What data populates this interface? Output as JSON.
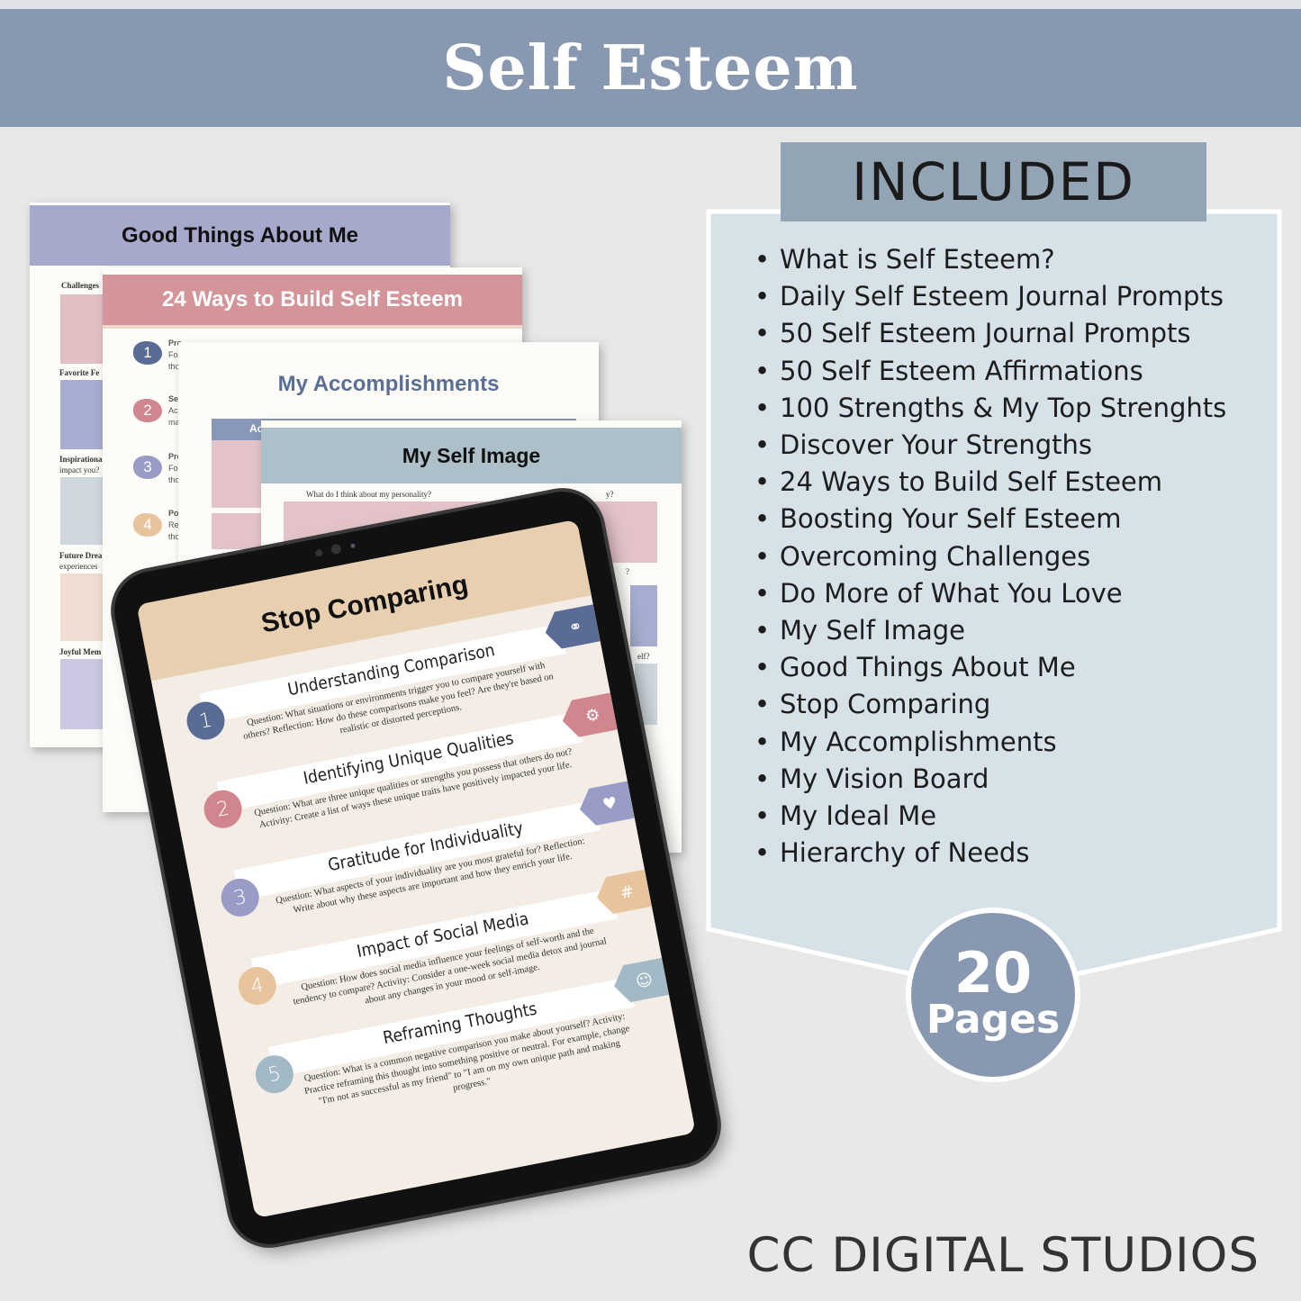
{
  "title": "Self Esteem",
  "colors": {
    "banner": "#8898b0",
    "panel": "#d6e1e8",
    "panel_header": "#93a5b5",
    "navy": "#5a6c96",
    "rose": "#d4959a",
    "lavender": "#9a9cc8",
    "sand": "#e8cfb0",
    "blue_grey": "#a3bac6"
  },
  "pages": {
    "good_things": {
      "title": "Good Things About Me",
      "labels": [
        "Challenges",
        "Favorite Fe",
        "Inspirationa",
        "impact you?",
        "Future Drea",
        "experiences",
        "Joyful Mem"
      ]
    },
    "ways": {
      "title": "24 Ways to Build Self Esteem",
      "numbers": [
        "1",
        "2",
        "3",
        "4"
      ],
      "stubs": [
        "Pro",
        "Foc",
        "tho",
        "Se",
        "Ack",
        "ma",
        "Pro",
        "Foc",
        "tho",
        "Po",
        "Rep",
        "tho"
      ]
    },
    "accomplishments": {
      "title": "My Accomplishments",
      "bar_stub": "Ac"
    },
    "self_image": {
      "title": "My Self Image",
      "question": "What do I think about my personality?",
      "stub1": "y?",
      "stub2": "?",
      "stub3": "elf?"
    }
  },
  "tablet": {
    "title": "Stop Comparing",
    "rows": [
      {
        "num": "1",
        "title": "Understanding Comparison",
        "text": "Question: What situations or environments trigger you to compare yourself with others? Reflection: How do these comparisons make you feel?  Are they're based on realistic or distorted perceptions.",
        "icon": "binoculars-icon",
        "color": "#5a6c96"
      },
      {
        "num": "2",
        "title": "Identifying Unique Qualities",
        "text": "Question: What are three unique qualities or strengths you possess that others do not? Activity: Create a list of ways these unique traits have positively impacted your life.",
        "icon": "magnifier-gear-icon",
        "color": "#d0868c"
      },
      {
        "num": "3",
        "title": "Gratitude for Individuality",
        "text": "Question: What aspects of your individuality are you most grateful for? Reflection: Write about why these aspects are important and how they enrich your life.",
        "icon": "heart-hands-icon",
        "color": "#9a9cc8"
      },
      {
        "num": "4",
        "title": "Impact of Social Media",
        "text": "Question: How does social media influence your feelings of self-worth and the tendency to compare? Activity: Consider a one-week social media detox and journal about any changes in your mood or self-image.",
        "icon": "social-media-icon",
        "color": "#e8c49c"
      },
      {
        "num": "5",
        "title": "Reframing Thoughts",
        "text": "Question: What is a common negative comparison you make about yourself? Activity: Practice reframing this thought into something positive or neutral. For example, change \"I'm not as successful as my friend\" to \"I am on my own unique path and making progress.\"",
        "icon": "head-thoughts-icon",
        "color": "#a3bac6"
      }
    ]
  },
  "included": {
    "header": "INCLUDED",
    "items": [
      "What is Self Esteem?",
      "Daily Self Esteem Journal Prompts",
      "50 Self Esteem Journal Prompts",
      "50 Self Esteem Affirmations",
      "100 Strengths & My Top Strenghts",
      "Discover Your Strengths",
      "24 Ways to Build Self Esteem",
      "Boosting Your Self Esteem",
      "Overcoming Challenges",
      "Do More of What You Love",
      "My Self Image",
      "Good Things About Me",
      "Stop Comparing",
      "My Accomplishments",
      "My Vision Board",
      "My Ideal Me",
      "Hierarchy of Needs"
    ]
  },
  "badge": {
    "number": "20",
    "label": "Pages"
  },
  "brand": "CC DIGITAL STUDIOS"
}
